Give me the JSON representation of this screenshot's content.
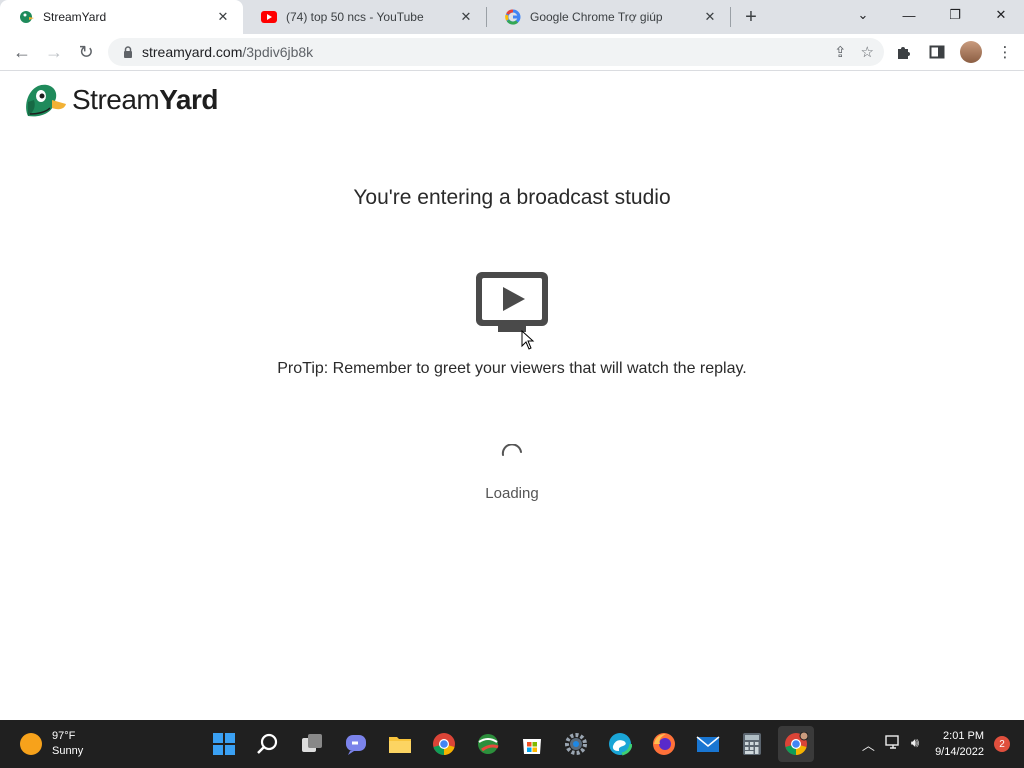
{
  "browser": {
    "tabs": [
      {
        "title": "StreamYard",
        "active": true,
        "favicon": "streamyard-duck-icon"
      },
      {
        "title": "(74) top 50 ncs - YouTube",
        "active": false,
        "favicon": "youtube-icon"
      },
      {
        "title": "Google Chrome Trợ giúp",
        "active": false,
        "favicon": "google-icon"
      }
    ],
    "new_tab_symbol": "+",
    "url_host": "streamyard.com",
    "url_path": "/3pdiv6jb8k"
  },
  "page": {
    "logo_text_light": "Stream",
    "logo_text_bold": "Yard",
    "heading": "You're entering a broadcast studio",
    "protip": "ProTip: Remember to greet your viewers that will watch the replay.",
    "loading": "Loading"
  },
  "taskbar": {
    "weather_temp": "97°F",
    "weather_desc": "Sunny",
    "time": "2:01 PM",
    "date": "9/14/2022",
    "notification_count": "2"
  },
  "colors": {
    "accent_duck_green": "#1f8a5b",
    "tabstrip_bg": "#dee1e6",
    "taskbar_bg": "#202020"
  }
}
